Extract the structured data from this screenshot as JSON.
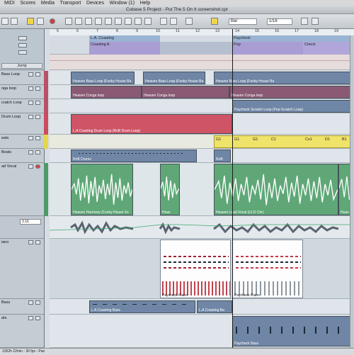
{
  "menu": [
    "MIDI",
    "Scores",
    "Media",
    "Transport",
    "Devices",
    "Window (1)",
    "Help"
  ],
  "window_title": "Cubase 5 Project - Put The 5 On It screenshot.cpr",
  "toolbar": {
    "quantize": "Bar",
    "snap": "1/16"
  },
  "ruler_ticks": [
    "5",
    "6",
    "7",
    "8",
    "9",
    "10",
    "11",
    "12",
    "13",
    "14",
    "15",
    "16",
    "17",
    "18",
    "19"
  ],
  "markers": [
    {
      "label": "L.A. Coasting",
      "color": "#9ab4d4"
    },
    {
      "label": "Coasting A",
      "color": "#a99ed4"
    },
    {
      "label": "Paycheck",
      "color": "#9ab4d4"
    },
    {
      "label": "Pop",
      "color": "#a99ed4"
    },
    {
      "label": "Check",
      "color": "#a99ed4"
    }
  ],
  "jump_label": "Jump",
  "tracks": [
    {
      "name": "Bass Loop"
    },
    {
      "name": "nga loop"
    },
    {
      "name": "cratch Loop"
    },
    {
      "name": "Drum Loop"
    },
    {
      "name": "eats"
    },
    {
      "name": "Beats"
    },
    {
      "name": "ad Vocal"
    },
    {
      "name": "3.16"
    },
    {
      "name": "iano"
    },
    {
      "name": "Bass"
    },
    {
      "name": "ats"
    }
  ],
  "parts": {
    "heaven_bass": "Heaven Bass Loop (Funky House Ba",
    "heaven_bass_2": "Heaven Bass Loop (Funky House Ba",
    "heaven_bass_3": "Heaven Bass Loop (Funky House Ba",
    "heaven_conga": "Heaven Conga loop",
    "heaven_conga_2": "Heaven Conga loop",
    "heaven_conga_3": "Heaven Conga loop",
    "paycheck_scratch": "Paycheck Scratch Loop (Pop Scratch Loop)",
    "la_coasting_drum": "L.A Coasting Drum Loop (RnB Drum Loop)",
    "rnb_drums": "RnB Drums",
    "rnb_b": "RnB",
    "heaven_harmony": "Heaven Harmony (Funky House Vo",
    "heaven_short": "Heav",
    "heaven_lead": "Heaven Lead Vocal (Lil D Chr)",
    "heaven_tail": "Heav",
    "paycheck_piano": "Paycheck Piano",
    "paycheck_piano_2": "Paycheck Piano",
    "la_coasting_bass": "L.A Coasting Bass",
    "la_coasting_bass_2": "L.A Coasting Ba",
    "paycheck_bass": "Paycheck Bass"
  },
  "chords": [
    "G1",
    "G1",
    "G1",
    "C1",
    "Cs1",
    "D1",
    "B1"
  ],
  "status": "1352h 22min - 30 fps - Pan"
}
